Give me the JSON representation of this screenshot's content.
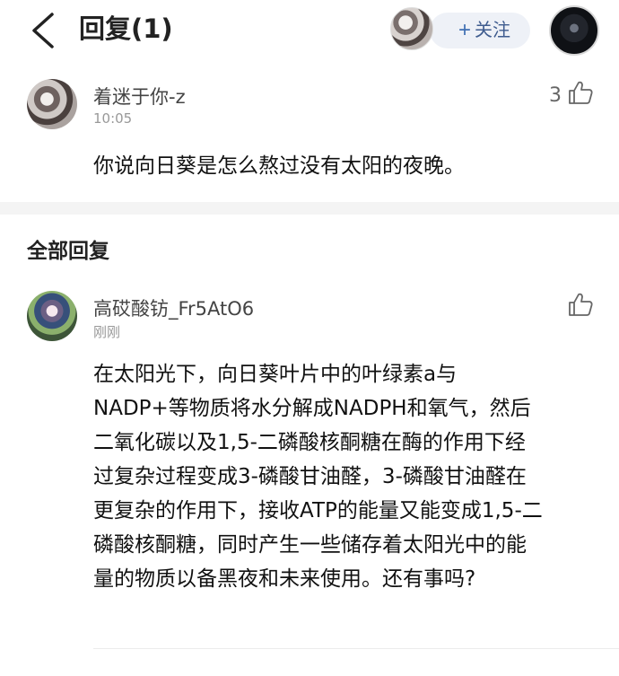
{
  "header": {
    "title": "回复(1)",
    "follow_label": "关注",
    "follow_plus": "+"
  },
  "main_comment": {
    "username": "着迷于你-z",
    "time": "10:05",
    "likes": "3",
    "text": "你说向日葵是怎么熬过没有太阳的夜晚。"
  },
  "section": {
    "title": "全部回复"
  },
  "reply": {
    "username": "高砹酸钫_Fr5AtO6",
    "time": "刚刚",
    "lines": [
      "在太阳光下，向日葵叶片中的叶绿素a与",
      "NADP+等物质将水分解成NADPH和氧气，然后",
      "二氧化碳以及1,5-二磷酸核酮糖在酶的作用下经",
      "过复杂过程变成3-磷酸甘油醛，3-磷酸甘油醛在",
      "更复杂的作用下，接收ATP的能量又能变成1,5-二",
      "磷酸核酮糖，同时产生一些储存着太阳光中的能",
      "量的物质以备黑夜和未来使用。还有事吗?"
    ]
  },
  "icons": {
    "back": "back-arrow-icon",
    "like": "thumbs-up-icon",
    "plus": "plus-icon"
  },
  "colors": {
    "follow_bg": "#eef1f7",
    "follow_text": "#3f5c8f",
    "divider": "#f4f4f4"
  }
}
